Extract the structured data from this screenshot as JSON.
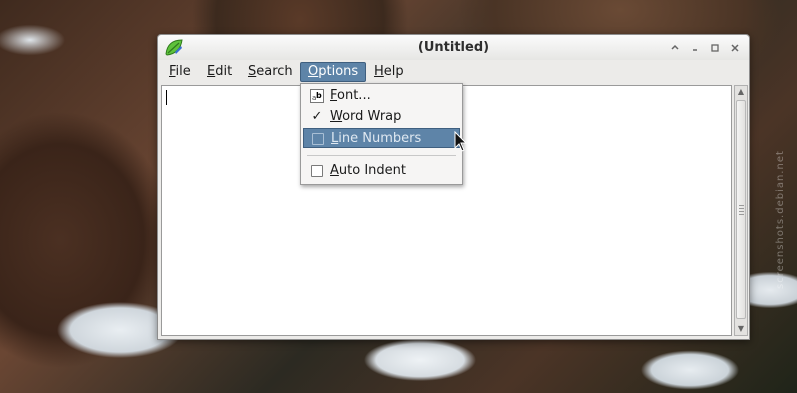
{
  "window": {
    "title": "(Untitled)",
    "controls": [
      "up-icon",
      "minimize-icon",
      "maximize-icon",
      "close-icon"
    ]
  },
  "menubar": {
    "items": [
      {
        "label": "File",
        "mnemonic": "F",
        "rest": "ile"
      },
      {
        "label": "Edit",
        "mnemonic": "E",
        "rest": "dit"
      },
      {
        "label": "Search",
        "mnemonic": "S",
        "rest": "earch"
      },
      {
        "label": "Options",
        "mnemonic": "O",
        "rest": "ptions",
        "active": true
      },
      {
        "label": "Help",
        "mnemonic": "H",
        "rest": "elp"
      }
    ]
  },
  "options_menu": {
    "items": [
      {
        "label": "Font...",
        "mnemonic": "F",
        "rest": "ont...",
        "icon": "font-icon"
      },
      {
        "label": "Word Wrap",
        "mnemonic": "W",
        "rest": "ord Wrap",
        "checked": true
      },
      {
        "label": "Line Numbers",
        "mnemonic": "L",
        "rest": "ine Numbers",
        "checked": false,
        "highlighted": true
      },
      {
        "label": "Auto Indent",
        "mnemonic": "A",
        "rest": "uto Indent",
        "checked": false
      }
    ]
  },
  "editor": {
    "content": ""
  },
  "colors": {
    "accent": "#5e84a8",
    "window_bg": "#ecebe9"
  },
  "watermark": "screenshots.debian.net"
}
